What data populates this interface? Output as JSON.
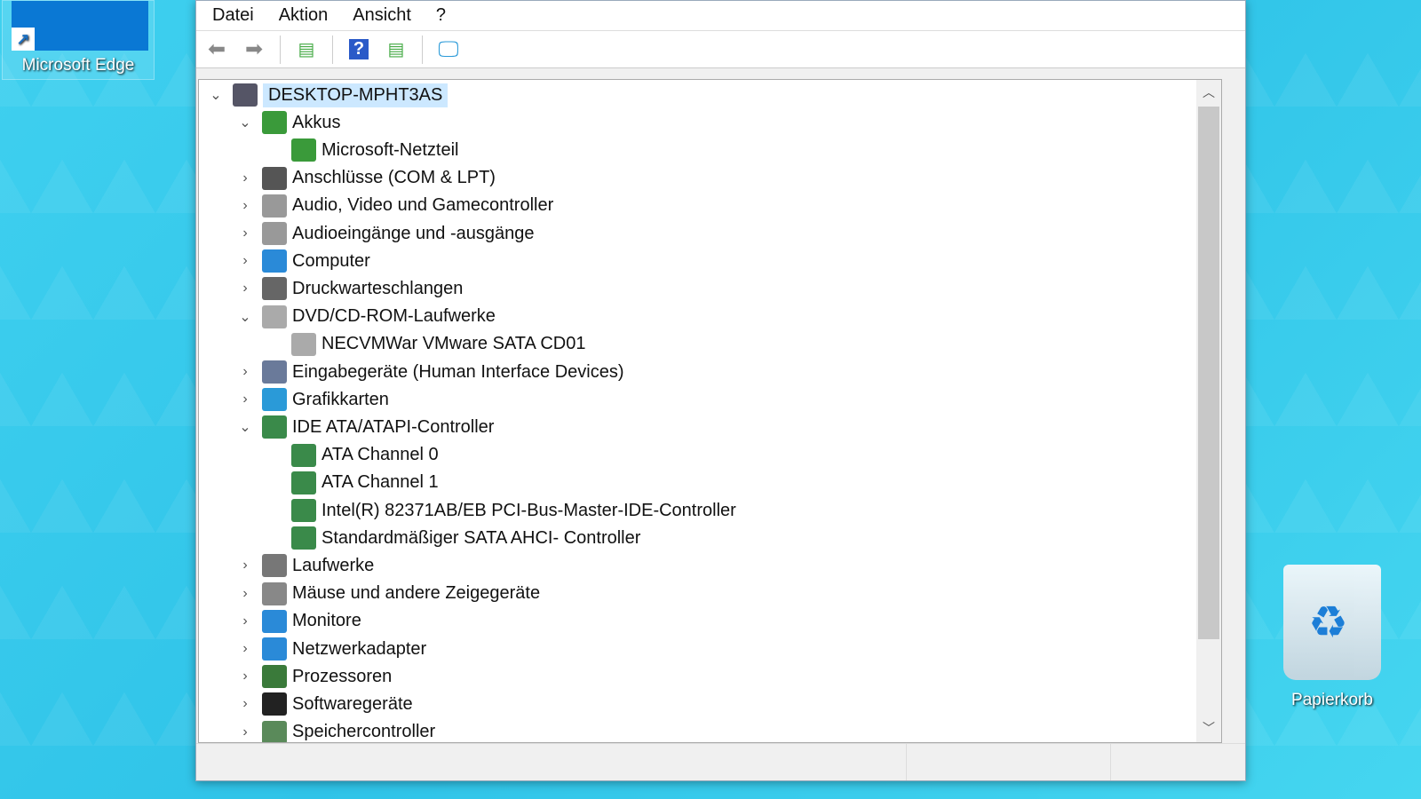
{
  "desktop": {
    "edge_label": "Microsoft Edge",
    "bin_label": "Papierkorb"
  },
  "menu": [
    "Datei",
    "Aktion",
    "Ansicht",
    "?"
  ],
  "tree": [
    {
      "label": "DESKTOP-MPHT3AS",
      "level": 0,
      "state": "open",
      "icon": "computer-root",
      "color": "#556",
      "selected": true
    },
    {
      "label": "Akkus",
      "level": 1,
      "state": "open",
      "icon": "battery",
      "color": "#3a9a3a"
    },
    {
      "label": "Microsoft-Netzteil",
      "level": 2,
      "state": "none",
      "icon": "battery",
      "color": "#3a9a3a"
    },
    {
      "label": "Anschlüsse (COM & LPT)",
      "level": 1,
      "state": "closed",
      "icon": "port",
      "color": "#555"
    },
    {
      "label": "Audio, Video und Gamecontroller",
      "level": 1,
      "state": "closed",
      "icon": "speaker",
      "color": "#999"
    },
    {
      "label": "Audioeingänge und -ausgänge",
      "level": 1,
      "state": "closed",
      "icon": "speaker",
      "color": "#999"
    },
    {
      "label": "Computer",
      "level": 1,
      "state": "closed",
      "icon": "monitor",
      "color": "#2a8ad8"
    },
    {
      "label": "Druckwarteschlangen",
      "level": 1,
      "state": "closed",
      "icon": "printer",
      "color": "#666"
    },
    {
      "label": "DVD/CD-ROM-Laufwerke",
      "level": 1,
      "state": "open",
      "icon": "disc",
      "color": "#aaa"
    },
    {
      "label": "NECVMWar VMware SATA CD01",
      "level": 2,
      "state": "none",
      "icon": "disc",
      "color": "#aaa"
    },
    {
      "label": "Eingabegeräte (Human Interface Devices)",
      "level": 1,
      "state": "closed",
      "icon": "hid",
      "color": "#6a7a9a"
    },
    {
      "label": "Grafikkarten",
      "level": 1,
      "state": "closed",
      "icon": "display-adapter",
      "color": "#2a9ad8"
    },
    {
      "label": "IDE ATA/ATAPI-Controller",
      "level": 1,
      "state": "open",
      "icon": "controller",
      "color": "#3a8a4a"
    },
    {
      "label": "ATA Channel 0",
      "level": 2,
      "state": "none",
      "icon": "controller",
      "color": "#3a8a4a"
    },
    {
      "label": "ATA Channel 1",
      "level": 2,
      "state": "none",
      "icon": "controller",
      "color": "#3a8a4a"
    },
    {
      "label": "Intel(R) 82371AB/EB PCI-Bus-Master-IDE-Controller",
      "level": 2,
      "state": "none",
      "icon": "controller",
      "color": "#3a8a4a"
    },
    {
      "label": "Standardmäßiger SATA AHCI- Controller",
      "level": 2,
      "state": "none",
      "icon": "controller",
      "color": "#3a8a4a"
    },
    {
      "label": "Laufwerke",
      "level": 1,
      "state": "closed",
      "icon": "drive",
      "color": "#777"
    },
    {
      "label": "Mäuse und andere Zeigegeräte",
      "level": 1,
      "state": "closed",
      "icon": "mouse",
      "color": "#888"
    },
    {
      "label": "Monitore",
      "level": 1,
      "state": "closed",
      "icon": "monitor",
      "color": "#2a8ad8"
    },
    {
      "label": "Netzwerkadapter",
      "level": 1,
      "state": "closed",
      "icon": "network",
      "color": "#2a8ad8"
    },
    {
      "label": "Prozessoren",
      "level": 1,
      "state": "closed",
      "icon": "cpu",
      "color": "#3a7a3a"
    },
    {
      "label": "Softwaregeräte",
      "level": 1,
      "state": "closed",
      "icon": "software-device",
      "color": "#222"
    },
    {
      "label": "Speichercontroller",
      "level": 1,
      "state": "closed",
      "icon": "storage-controller",
      "color": "#5a8a5a"
    }
  ]
}
